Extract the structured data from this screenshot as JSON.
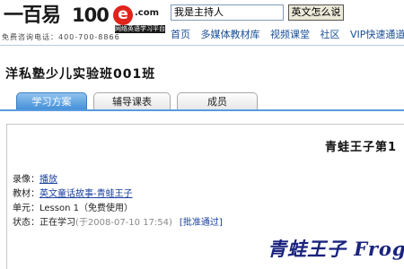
{
  "header": {
    "logo_chinese": "一百易",
    "logo_number": "100",
    "logo_e": "e",
    "logo_com": ".com",
    "logo_slogan": "网络英语学习平台",
    "hotline": "免费咨询电话：400-700-8866",
    "search_value": "我是主持人",
    "search_button": "英文怎么说"
  },
  "nav": {
    "items": [
      "首页",
      "多媒体教材库",
      "视频课堂",
      "社区",
      "VIP快速通道"
    ]
  },
  "class_title": "洋私塾少儿实验班001班",
  "tabs": [
    {
      "label": "学习方案",
      "active": true
    },
    {
      "label": "辅导课表",
      "active": false
    },
    {
      "label": "成员",
      "active": false
    }
  ],
  "lesson": {
    "heading": "青蛙王子第1",
    "recording_label": "录像：",
    "recording_link": "播放",
    "textbook_label": "教材：",
    "textbook_link": "英文童话故事-青蛙王子",
    "unit_label": "单元：",
    "unit_value": "Lesson 1（免费使用）",
    "status_label": "状态：",
    "status_value": "正在学习",
    "status_date": "(于2008-07-10 17:54)",
    "approve_link": "[批准通过]",
    "big_title": "青蛙王子 Frog"
  },
  "colors": {
    "nav_link": "#1a4f96",
    "tab_active": "#3d8bd6",
    "link": "#1a3fa0",
    "big_title": "#1a237e",
    "logo_red": "#e0241b"
  }
}
